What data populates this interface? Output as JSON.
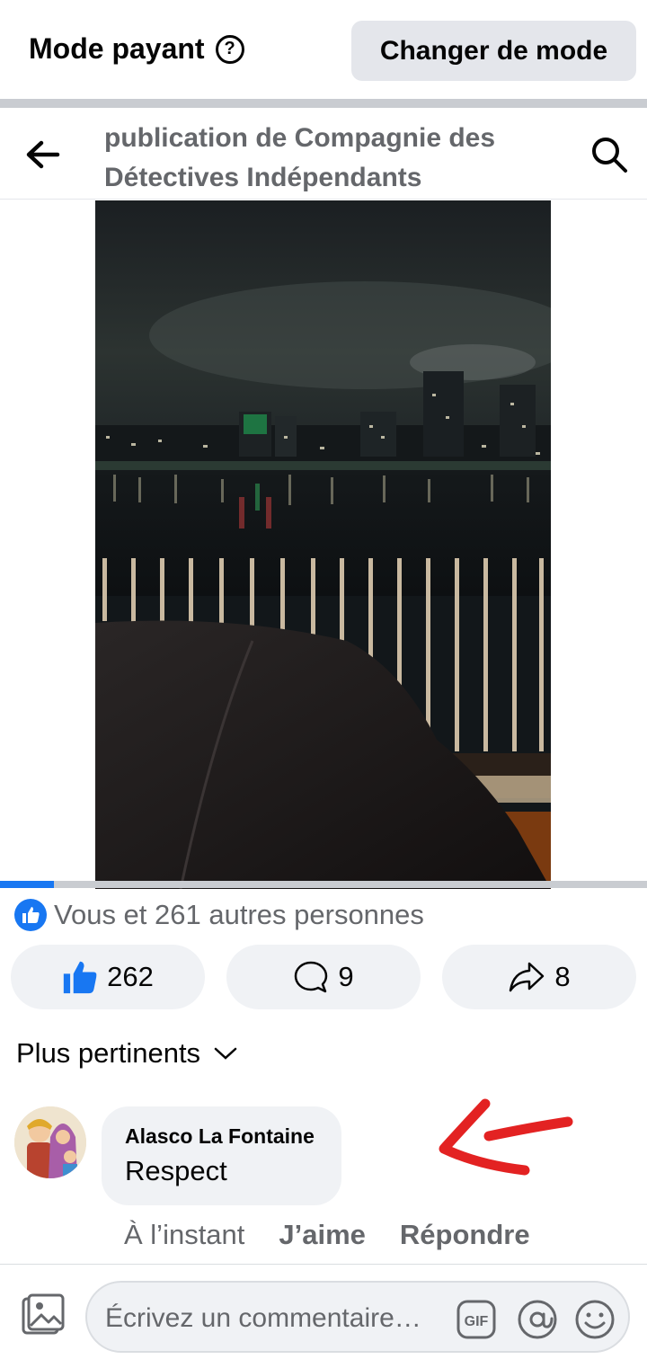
{
  "mode_bar": {
    "title": "Mode payant",
    "help_icon": "?",
    "change_mode_label": "Changer de mode"
  },
  "post_header": {
    "title": "publication de Compagnie des Détectives Indépendants",
    "back_icon": "arrow-left-icon",
    "search_icon": "search-icon"
  },
  "video": {
    "progress": 0.083,
    "accent_color": "#1877f2"
  },
  "reactions": {
    "summary": "Vous et 261 autres personnes",
    "like_count": "262",
    "comment_count": "9",
    "share_count": "8"
  },
  "sort": {
    "label": "Plus pertinents"
  },
  "comment": {
    "author": "Alasco La Fontaine",
    "text": "Respect",
    "time": "À l’instant",
    "like_label": "J’aime",
    "reply_label": "Répondre"
  },
  "composer": {
    "placeholder": "Écrivez un commentaire…",
    "gif_label": "GIF"
  }
}
